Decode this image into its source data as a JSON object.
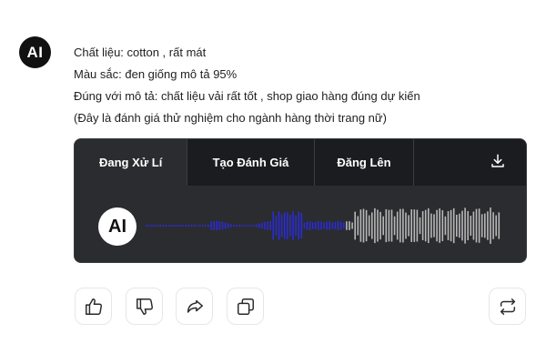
{
  "assistant": {
    "avatar_text": "AI"
  },
  "message": {
    "lines": [
      "Chất liệu: cotton , rất mát",
      "Màu sắc: đen giống mô tả 95%",
      "Đúng với mô tả: chất liệu vải rất tốt , shop giao hàng đúng dự kiến",
      "(Đây là đánh giá thử nghiệm cho ngành hàng thời trang nữ)"
    ]
  },
  "player": {
    "tabs": [
      {
        "label": "Đang Xử Lí",
        "active": true
      },
      {
        "label": "Tạo Đánh Giá",
        "active": false
      },
      {
        "label": "Đăng Lên",
        "active": false
      }
    ],
    "download_icon": "download-icon",
    "avatar_text": "AI",
    "progress": 0.36,
    "colors": {
      "played": "#2b2bd6",
      "unplayed": "#b8b8b8",
      "background": "#2b2c2f",
      "tab_background": "#1b1c1f"
    }
  },
  "actions": [
    {
      "name": "like-button",
      "icon": "thumbs-up-icon"
    },
    {
      "name": "dislike-button",
      "icon": "thumbs-down-icon"
    },
    {
      "name": "share-button",
      "icon": "share-icon"
    },
    {
      "name": "copy-button",
      "icon": "copy-icon"
    },
    {
      "name": "regenerate-button",
      "icon": "repeat-icon"
    }
  ]
}
